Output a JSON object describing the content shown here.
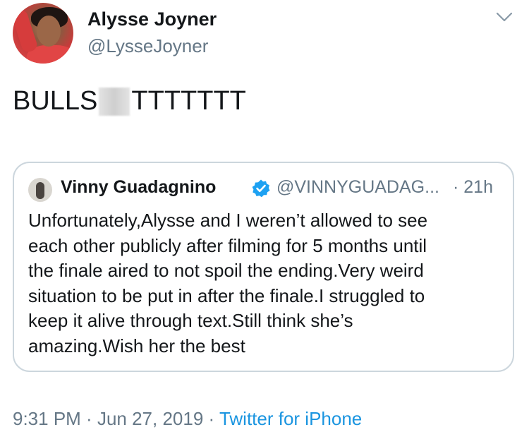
{
  "author": {
    "display_name": "Alysse Joyner",
    "handle": "@LysseJoyner",
    "avatar_icon": "user-avatar"
  },
  "tweet": {
    "text_before": "BULLS",
    "text_after": "TTTTTTT"
  },
  "quoted_tweet": {
    "display_name": "Vinny Guadagnino",
    "handle": "@VINNYGUADAG...",
    "time": "· 21h",
    "verified": true,
    "body_lines": [
      "Unfortunately,Alysse and I weren’t allowed to see",
      "each other publicly after filming for 5 months until",
      "the finale aired to not spoil the ending.Very weird",
      "situation to be put in after the finale.I struggled to",
      "keep it alive through text.Still think she’s",
      "amazing.Wish her the best"
    ]
  },
  "meta": {
    "time": "9:31 PM",
    "separator1": " · ",
    "date": "Jun 27, 2019",
    "separator2": " · ",
    "source": "Twitter for iPhone"
  },
  "colors": {
    "text": "#14171a",
    "secondary": "#657786",
    "link": "#1b95e0",
    "border": "#ccd6dd",
    "verified": "#1da1f2"
  }
}
